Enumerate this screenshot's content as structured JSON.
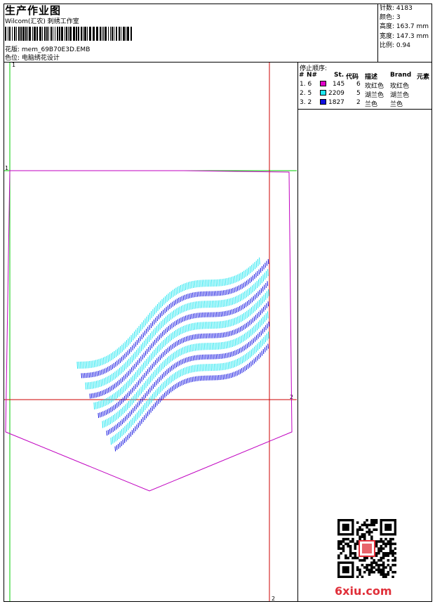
{
  "header": {
    "title": "生产作业图",
    "subtitle": "Wilcom(汇农) 刺绣工作室",
    "design_file": "花版: mem_69B70E3D.EMB",
    "position": "色位: 电脑绣花设计"
  },
  "stats": {
    "stitches": "针数: 4183",
    "colors": "颜色: 3",
    "height": "高度: 163.7 mm",
    "width": "宽度: 147.3 mm",
    "scale": "比例: 0.94"
  },
  "stop_sequence": {
    "title": "停止顺序:",
    "columns": [
      "#",
      "N#",
      "St.",
      "代码",
      "描述",
      "Brand",
      "元素"
    ],
    "rows": [
      {
        "index": "1. 6",
        "color": "#e000c8",
        "stitches": "145",
        "code": "6",
        "desc": "玫红色",
        "brand": "玫红色"
      },
      {
        "index": "2. 5",
        "color": "#1ee6f0",
        "stitches": "2209",
        "code": "5",
        "desc": "湖兰色",
        "brand": "湖兰色"
      },
      {
        "index": "3. 2",
        "color": "#1010e0",
        "stitches": "1827",
        "code": "2",
        "desc": "兰色",
        "brand": "兰色"
      }
    ]
  },
  "guides": {
    "v1": "1",
    "h1": "1",
    "h2": "2",
    "v2": "2"
  },
  "colors": {
    "guide_green": "#00cc00",
    "guide_red": "#cc0000",
    "outline_magenta": "#c000c0",
    "wave_cyan": "#1ee6f0",
    "wave_blue": "#1010e0",
    "watermark_red": "#e0303a"
  },
  "watermark": {
    "text": "6xiu.com"
  }
}
